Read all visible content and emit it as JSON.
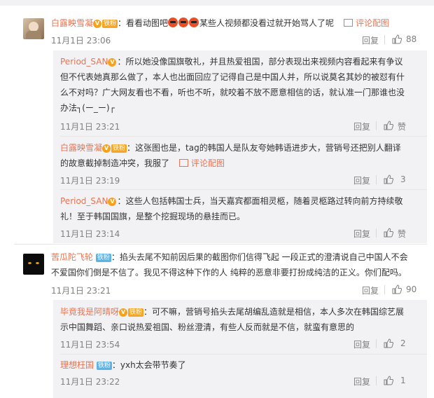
{
  "comments": [
    {
      "name": "白露映雪凝",
      "badge": "铁粉",
      "text_pre": "：看看动图吧",
      "text_post": "某些人视频都没看过就开始骂人了呢",
      "pic_label": "评论配图",
      "time": "11月1日 23:06",
      "reply_label": "回复",
      "like_count": "88"
    },
    {
      "name": "苦瓜陀飞轮",
      "badge": "铁粉",
      "line1": "：掐头去尾不知前因后果的截图你们信得飞起 一段正式的澄清说自己中国人不会",
      "line2": "不爱国你们倒是不信了。我见不得这种下作的人 纯粹的恶意非要打扮成纯洁的正义。你们配吗。",
      "time": "11月1日 23:21",
      "reply_label": "回复",
      "like_count": "90"
    }
  ],
  "replies_a": [
    {
      "name": "Period_SAN",
      "line1": "：所以她没像国旗敬礼，并且热爱祖国，部分表现出来视频内容看起来有争议",
      "line2": "但不代表她真那么做了，本人也出面回应了记得自己是中国人并，所以说莫名其妙的被怼有什",
      "line3": "么不对吗？广大网友看也不看，听也不听，就咬着不放不愿意相信的话，就认准一门那谁也没",
      "line4": "办法┐(ー_ー)┌",
      "time": "11月1日 23:21",
      "reply_label": "回复",
      "like_label": "赞"
    },
    {
      "name": "白露映雪凝",
      "badge": "铁粉",
      "line1": "：这张图也是，tag的韩国人是队友夸她韩语进步大，营销号还把别人翻译",
      "line2": "的故意截掉制造冲突，我服了",
      "pic_label": "评论配图",
      "time": "11月1日 23:19",
      "reply_label": "回复",
      "like_count": "3"
    },
    {
      "name": "Period_SAN",
      "line1": "：这些人包括韩国士兵，当天嘉宾都面相灵柩，随着灵柩路过转向前方持续敬",
      "line2": "礼！至于韩国国旗，是整个挖掘现场的悬挂而已。",
      "time": "11月1日 23:14",
      "reply_label": "回复",
      "like_label": "赞"
    }
  ],
  "replies_b": [
    {
      "name": "毕竟我是阿晴呀",
      "badge": "铁粉",
      "line1": "：可不嘛，营销号掐头去尾胡编乱造就是相信，本人多次在韩国综艺展",
      "line2": "示中国舞蹈、亲口说热爱祖国、粉丝澄清，有些人反而就是不信，就蛮有意思的",
      "time": "11月1日 23:54",
      "reply_label": "回复",
      "like_count": "2"
    },
    {
      "name": "理想枉国",
      "badge": "铁粉",
      "line1": "：yxh太会带节奏了",
      "time": "11月1日 23:22",
      "reply_label": "回复",
      "like_count": "1"
    }
  ],
  "colors": {
    "name": "#eb7350",
    "meta": "#808080",
    "sub_bg": "#f2f2f5"
  }
}
